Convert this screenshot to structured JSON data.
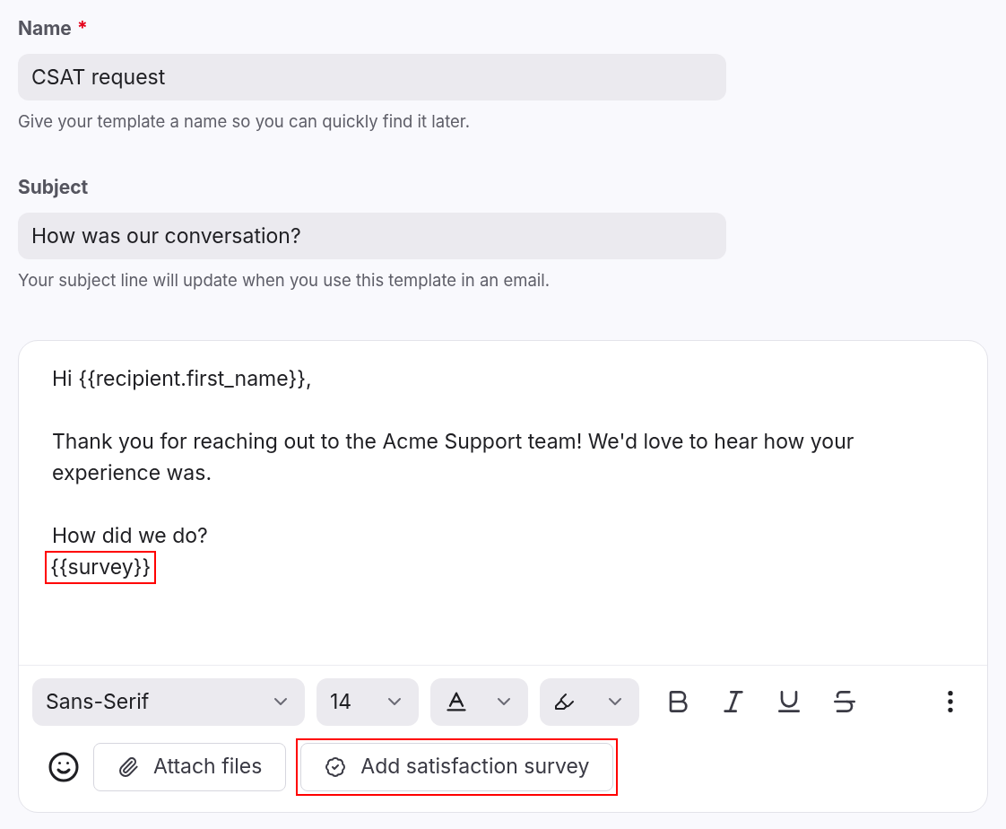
{
  "fields": [
    {
      "label": "Name",
      "required": true,
      "value": "CSAT request",
      "help": "Give your template a name so you can quickly find it later."
    },
    {
      "label": "Subject",
      "required": false,
      "value": "How was our conversation?",
      "help": "Your subject line will update when you use this template in an email."
    }
  ],
  "required_mark": "*",
  "editor": {
    "paragraphs": [
      {
        "lines": [
          {
            "text": "Hi {{recipient.first_name}},",
            "highlighted": false
          }
        ]
      },
      {
        "lines": [
          {
            "text": "Thank you for reaching out to the Acme Support team! We'd love to hear how your experience was.",
            "highlighted": false
          }
        ]
      },
      {
        "lines": [
          {
            "text": "How did we do?",
            "highlighted": false
          },
          {
            "text": "{{survey}}",
            "highlighted": true
          }
        ]
      }
    ],
    "toolbar": {
      "font": "Sans-Serif",
      "size": "14"
    },
    "actions": [
      {
        "kind": "attach",
        "label": "Attach files",
        "highlighted": false
      },
      {
        "kind": "survey",
        "label": "Add satisfaction survey",
        "highlighted": true
      }
    ]
  }
}
